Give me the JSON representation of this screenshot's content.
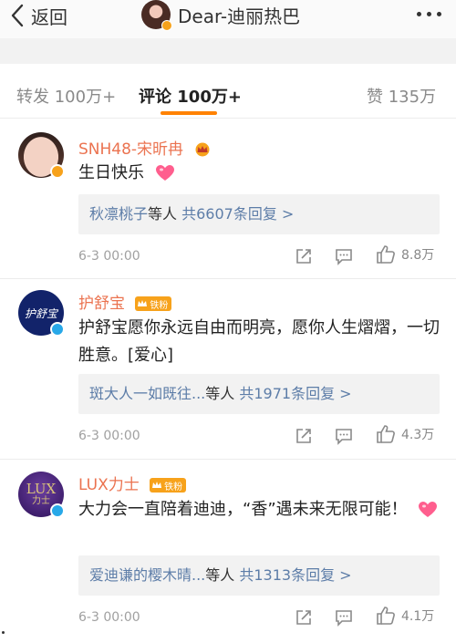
{
  "nav": {
    "back_label": "返回",
    "title": "Dear-迪丽热巴"
  },
  "tabs": {
    "repost": "转发 100万+",
    "comments": "评论 100万+",
    "likes": "赞 135万"
  },
  "comments": [
    {
      "username": "SNH48-宋昕冉",
      "text": "生日快乐",
      "reply_names": "秋凛桃子",
      "reply_suffix": "等人",
      "reply_count": "共6607条回复 >",
      "time": "6-3 00:00",
      "likes": "8.8万"
    },
    {
      "username": "护舒宝",
      "badge": "铁粉",
      "avatar_text": "护舒宝",
      "text": "护舒宝愿你永远自由而明亮，愿你人生熠熠，一切胜意。[爱心]",
      "reply_names": "斑大人一如既往...",
      "reply_suffix": "等人",
      "reply_count": "共1971条回复 >",
      "time": "6-3 00:00",
      "likes": "4.3万"
    },
    {
      "username": "LUX力士",
      "badge": "铁粉",
      "avatar_text": "LUX",
      "avatar_sub": "力士",
      "text": "大力会一直陪着迪迪，“香”遇未来无限可能！",
      "reply_names": "爱迪谦的樱木晴...",
      "reply_suffix": "等人",
      "reply_count": "共1313条回复 >",
      "time": "6-3 00:00",
      "likes": "4.1万"
    }
  ],
  "colors": {
    "accent_orange": "#ff8200",
    "username_orange": "#eb7350",
    "link_blue": "#5d7da8",
    "reply_bg": "#f2f2f2"
  },
  "icons": {
    "back": "chevron-left-icon",
    "more": "more-dots-icon",
    "crown": "crown-icon",
    "iron_fan": "iron-fan-badge-icon",
    "heart": "heart-emoji-icon",
    "share": "share-icon",
    "comment": "comment-icon",
    "like": "thumbs-up-icon",
    "verified_gold": "verified-gold-icon",
    "verified_blue": "verified-blue-icon"
  }
}
